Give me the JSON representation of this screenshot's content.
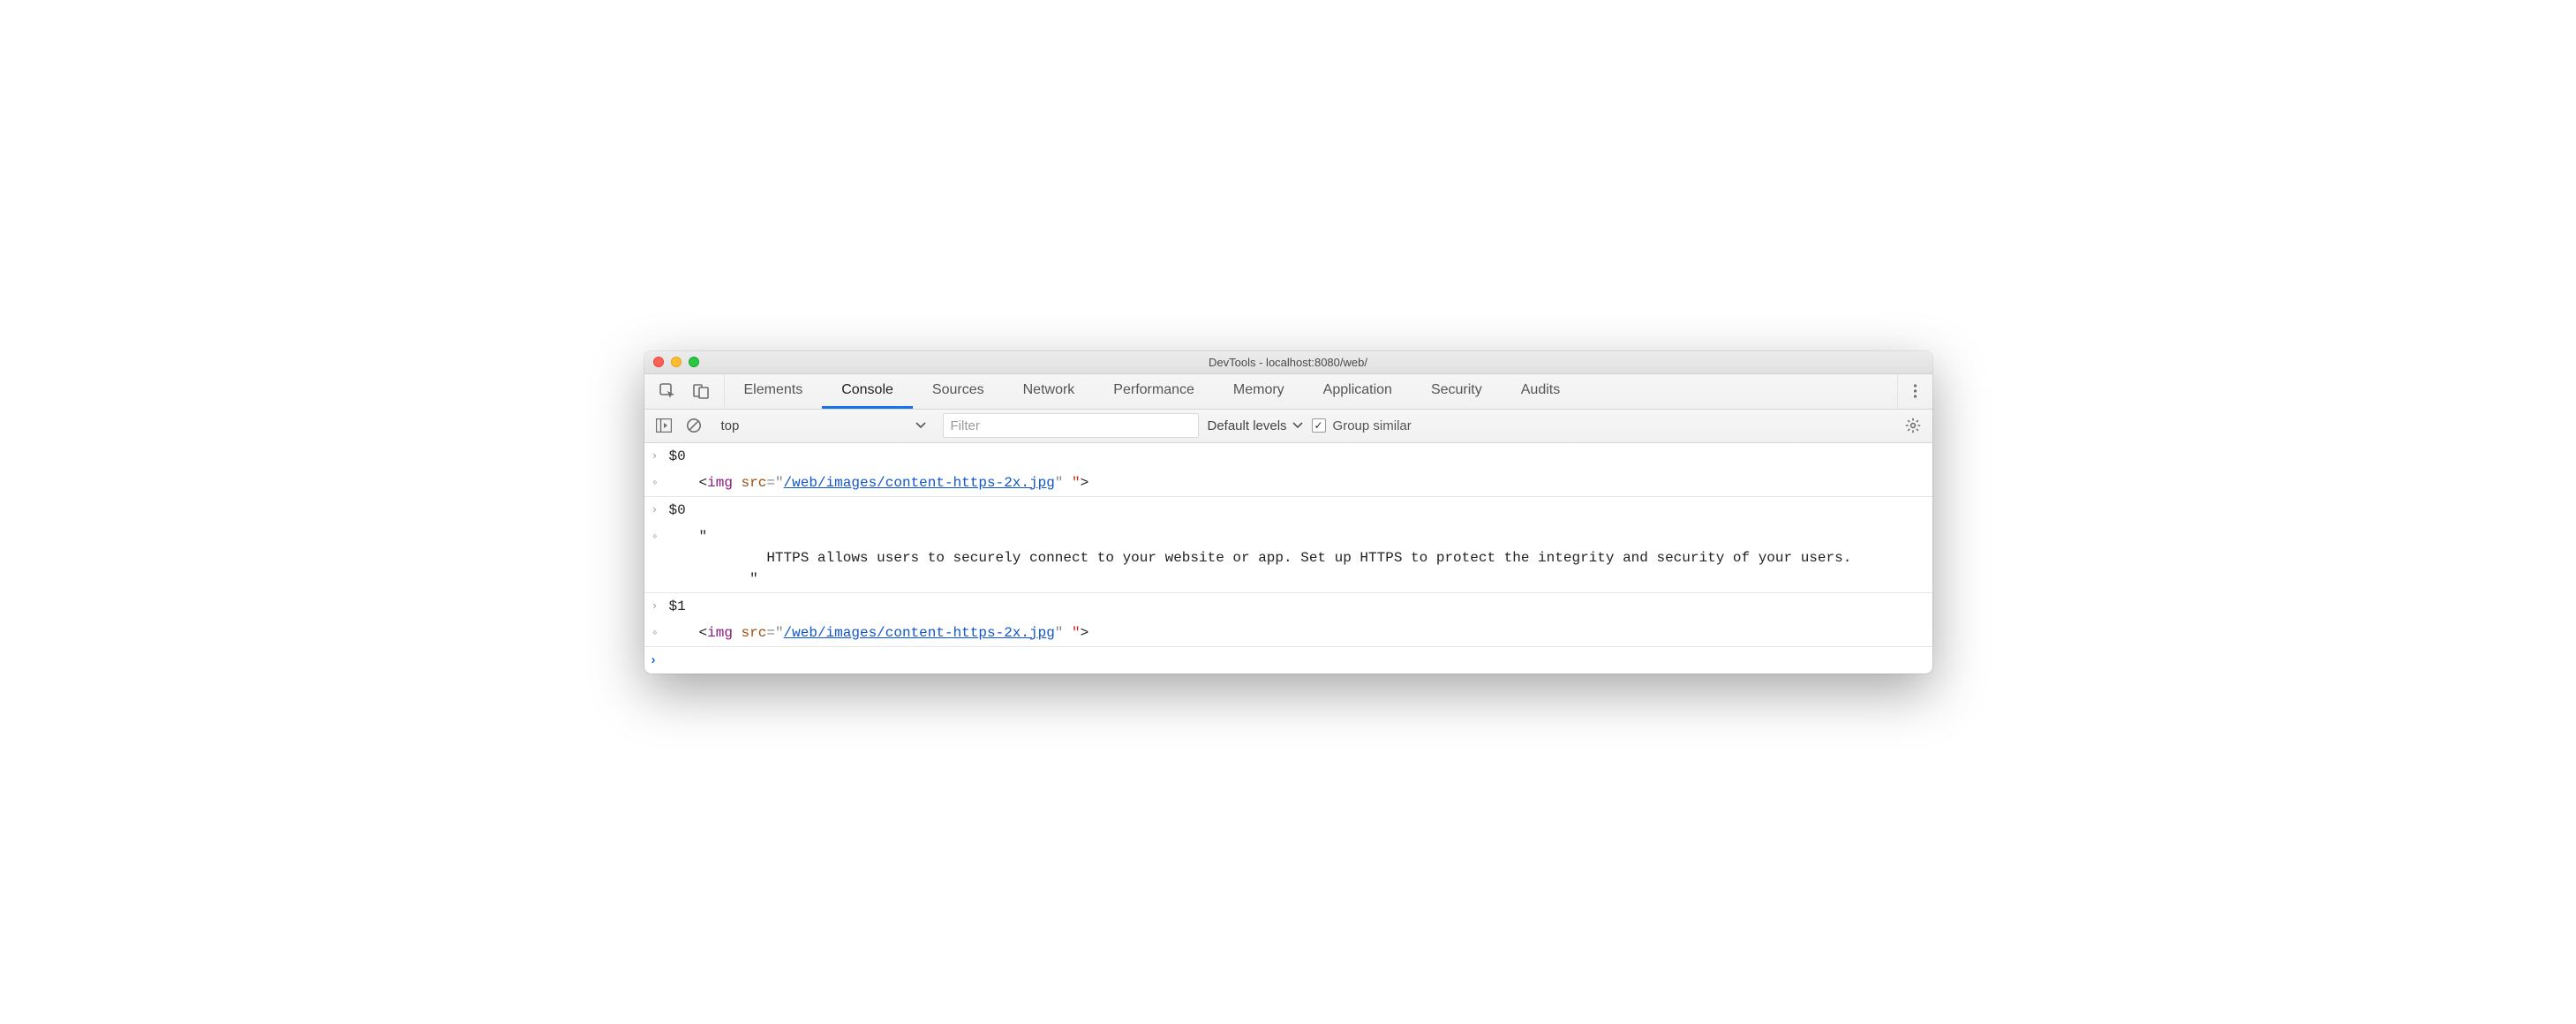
{
  "window": {
    "title": "DevTools - localhost:8080/web/"
  },
  "tabs": [
    {
      "label": "Elements"
    },
    {
      "label": "Console",
      "active": true
    },
    {
      "label": "Sources"
    },
    {
      "label": "Network"
    },
    {
      "label": "Performance"
    },
    {
      "label": "Memory"
    },
    {
      "label": "Application"
    },
    {
      "label": "Security"
    },
    {
      "label": "Audits"
    }
  ],
  "toolbar": {
    "context": "top",
    "filter_placeholder": "Filter",
    "levels_label": "Default levels",
    "group_similar_label": "Group similar",
    "group_similar_checked": true
  },
  "entries": [
    {
      "kind": "input",
      "text": "$0"
    },
    {
      "kind": "output",
      "html_preview": {
        "tag": "img",
        "attr": "src",
        "value": "/web/images/content-https-2x.jpg",
        "trailing": " \""
      }
    },
    {
      "kind": "input",
      "text": "$0"
    },
    {
      "kind": "output",
      "text": "\"\n        HTTPS allows users to securely connect to your website or app. Set up HTTPS to protect the integrity and security of your users.\n      \""
    },
    {
      "kind": "input",
      "text": "$1"
    },
    {
      "kind": "output",
      "html_preview": {
        "tag": "img",
        "attr": "src",
        "value": "/web/images/content-https-2x.jpg",
        "trailing": " \""
      }
    }
  ],
  "prompt": {
    "value": ""
  }
}
